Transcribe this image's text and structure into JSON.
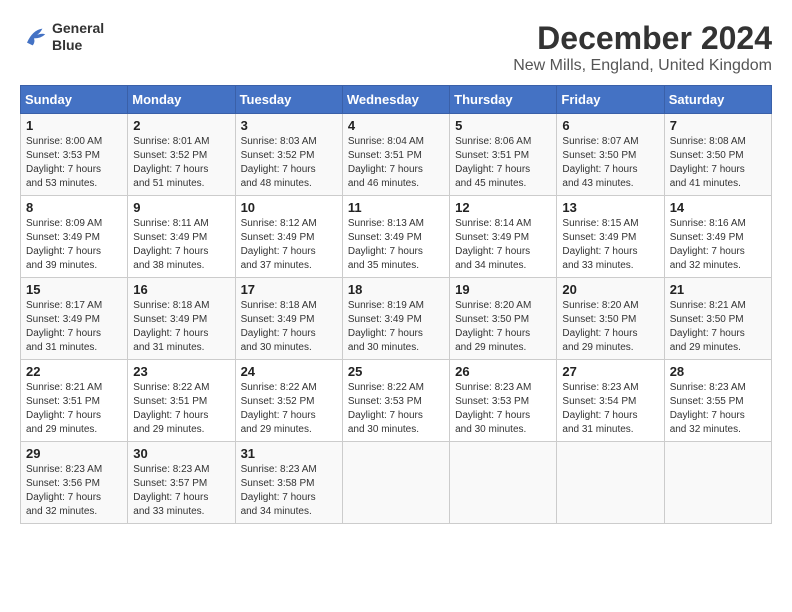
{
  "header": {
    "logo_line1": "General",
    "logo_line2": "Blue",
    "title": "December 2024",
    "subtitle": "New Mills, England, United Kingdom"
  },
  "calendar": {
    "days_of_week": [
      "Sunday",
      "Monday",
      "Tuesday",
      "Wednesday",
      "Thursday",
      "Friday",
      "Saturday"
    ],
    "weeks": [
      [
        {
          "day": "",
          "info": ""
        },
        {
          "day": "2",
          "info": "Sunrise: 8:01 AM\nSunset: 3:52 PM\nDaylight: 7 hours\nand 51 minutes."
        },
        {
          "day": "3",
          "info": "Sunrise: 8:03 AM\nSunset: 3:52 PM\nDaylight: 7 hours\nand 48 minutes."
        },
        {
          "day": "4",
          "info": "Sunrise: 8:04 AM\nSunset: 3:51 PM\nDaylight: 7 hours\nand 46 minutes."
        },
        {
          "day": "5",
          "info": "Sunrise: 8:06 AM\nSunset: 3:51 PM\nDaylight: 7 hours\nand 45 minutes."
        },
        {
          "day": "6",
          "info": "Sunrise: 8:07 AM\nSunset: 3:50 PM\nDaylight: 7 hours\nand 43 minutes."
        },
        {
          "day": "7",
          "info": "Sunrise: 8:08 AM\nSunset: 3:50 PM\nDaylight: 7 hours\nand 41 minutes."
        }
      ],
      [
        {
          "day": "1",
          "info": "Sunrise: 8:00 AM\nSunset: 3:53 PM\nDaylight: 7 hours\nand 53 minutes."
        },
        {
          "day": "9",
          "info": "Sunrise: 8:11 AM\nSunset: 3:49 PM\nDaylight: 7 hours\nand 38 minutes."
        },
        {
          "day": "10",
          "info": "Sunrise: 8:12 AM\nSunset: 3:49 PM\nDaylight: 7 hours\nand 37 minutes."
        },
        {
          "day": "11",
          "info": "Sunrise: 8:13 AM\nSunset: 3:49 PM\nDaylight: 7 hours\nand 35 minutes."
        },
        {
          "day": "12",
          "info": "Sunrise: 8:14 AM\nSunset: 3:49 PM\nDaylight: 7 hours\nand 34 minutes."
        },
        {
          "day": "13",
          "info": "Sunrise: 8:15 AM\nSunset: 3:49 PM\nDaylight: 7 hours\nand 33 minutes."
        },
        {
          "day": "14",
          "info": "Sunrise: 8:16 AM\nSunset: 3:49 PM\nDaylight: 7 hours\nand 32 minutes."
        }
      ],
      [
        {
          "day": "8",
          "info": "Sunrise: 8:09 AM\nSunset: 3:49 PM\nDaylight: 7 hours\nand 39 minutes."
        },
        {
          "day": "16",
          "info": "Sunrise: 8:18 AM\nSunset: 3:49 PM\nDaylight: 7 hours\nand 31 minutes."
        },
        {
          "day": "17",
          "info": "Sunrise: 8:18 AM\nSunset: 3:49 PM\nDaylight: 7 hours\nand 30 minutes."
        },
        {
          "day": "18",
          "info": "Sunrise: 8:19 AM\nSunset: 3:49 PM\nDaylight: 7 hours\nand 30 minutes."
        },
        {
          "day": "19",
          "info": "Sunrise: 8:20 AM\nSunset: 3:50 PM\nDaylight: 7 hours\nand 29 minutes."
        },
        {
          "day": "20",
          "info": "Sunrise: 8:20 AM\nSunset: 3:50 PM\nDaylight: 7 hours\nand 29 minutes."
        },
        {
          "day": "21",
          "info": "Sunrise: 8:21 AM\nSunset: 3:50 PM\nDaylight: 7 hours\nand 29 minutes."
        }
      ],
      [
        {
          "day": "15",
          "info": "Sunrise: 8:17 AM\nSunset: 3:49 PM\nDaylight: 7 hours\nand 31 minutes."
        },
        {
          "day": "23",
          "info": "Sunrise: 8:22 AM\nSunset: 3:51 PM\nDaylight: 7 hours\nand 29 minutes."
        },
        {
          "day": "24",
          "info": "Sunrise: 8:22 AM\nSunset: 3:52 PM\nDaylight: 7 hours\nand 29 minutes."
        },
        {
          "day": "25",
          "info": "Sunrise: 8:22 AM\nSunset: 3:53 PM\nDaylight: 7 hours\nand 30 minutes."
        },
        {
          "day": "26",
          "info": "Sunrise: 8:23 AM\nSunset: 3:53 PM\nDaylight: 7 hours\nand 30 minutes."
        },
        {
          "day": "27",
          "info": "Sunrise: 8:23 AM\nSunset: 3:54 PM\nDaylight: 7 hours\nand 31 minutes."
        },
        {
          "day": "28",
          "info": "Sunrise: 8:23 AM\nSunset: 3:55 PM\nDaylight: 7 hours\nand 32 minutes."
        }
      ],
      [
        {
          "day": "22",
          "info": "Sunrise: 8:21 AM\nSunset: 3:51 PM\nDaylight: 7 hours\nand 29 minutes."
        },
        {
          "day": "30",
          "info": "Sunrise: 8:23 AM\nSunset: 3:57 PM\nDaylight: 7 hours\nand 33 minutes."
        },
        {
          "day": "31",
          "info": "Sunrise: 8:23 AM\nSunset: 3:58 PM\nDaylight: 7 hours\nand 34 minutes."
        },
        {
          "day": "",
          "info": ""
        },
        {
          "day": "",
          "info": ""
        },
        {
          "day": "",
          "info": ""
        },
        {
          "day": "",
          "info": ""
        }
      ],
      [
        {
          "day": "29",
          "info": "Sunrise: 8:23 AM\nSunset: 3:56 PM\nDaylight: 7 hours\nand 32 minutes."
        },
        {
          "day": "",
          "info": ""
        },
        {
          "day": "",
          "info": ""
        },
        {
          "day": "",
          "info": ""
        },
        {
          "day": "",
          "info": ""
        },
        {
          "day": "",
          "info": ""
        },
        {
          "day": "",
          "info": ""
        }
      ]
    ]
  }
}
